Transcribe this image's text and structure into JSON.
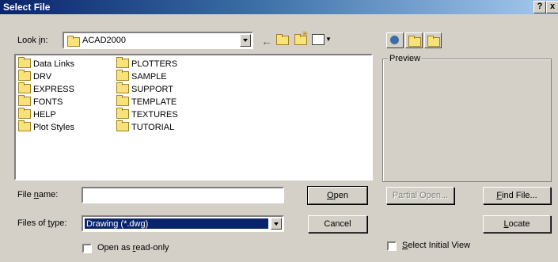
{
  "title": "Select File",
  "title_buttons": {
    "help": "?",
    "close": "x"
  },
  "look_in": {
    "label_pre": "Look ",
    "label_u": "i",
    "label_post": "n:",
    "value": "ACAD2000"
  },
  "files": [
    {
      "name": "Data Links"
    },
    {
      "name": "DRV"
    },
    {
      "name": "EXPRESS"
    },
    {
      "name": "FONTS"
    },
    {
      "name": "HELP"
    },
    {
      "name": "Plot Styles"
    },
    {
      "name": "PLOTTERS"
    },
    {
      "name": "SAMPLE"
    },
    {
      "name": "SUPPORT"
    },
    {
      "name": "TEMPLATE"
    },
    {
      "name": "TEXTURES"
    },
    {
      "name": "TUTORIAL"
    }
  ],
  "preview_label": "Preview",
  "file_name": {
    "label_pre": "File ",
    "label_u": "n",
    "label_post": "ame:",
    "value": ""
  },
  "file_type": {
    "label_pre": "Files of ",
    "label_u": "t",
    "label_post": "ype:",
    "value": "Drawing (*.dwg)"
  },
  "buttons": {
    "open": {
      "u": "O",
      "rest": "pen"
    },
    "cancel": "Cancel",
    "partial_open": "Partial Open...",
    "find_file": {
      "u": "F",
      "rest": "ind File..."
    },
    "locate": {
      "u": "L",
      "rest": "ocate"
    }
  },
  "open_readonly": {
    "pre": "Open as ",
    "u": "r",
    "post": "ead-only"
  },
  "select_initial_view": {
    "u": "S",
    "rest": "elect Initial View"
  }
}
